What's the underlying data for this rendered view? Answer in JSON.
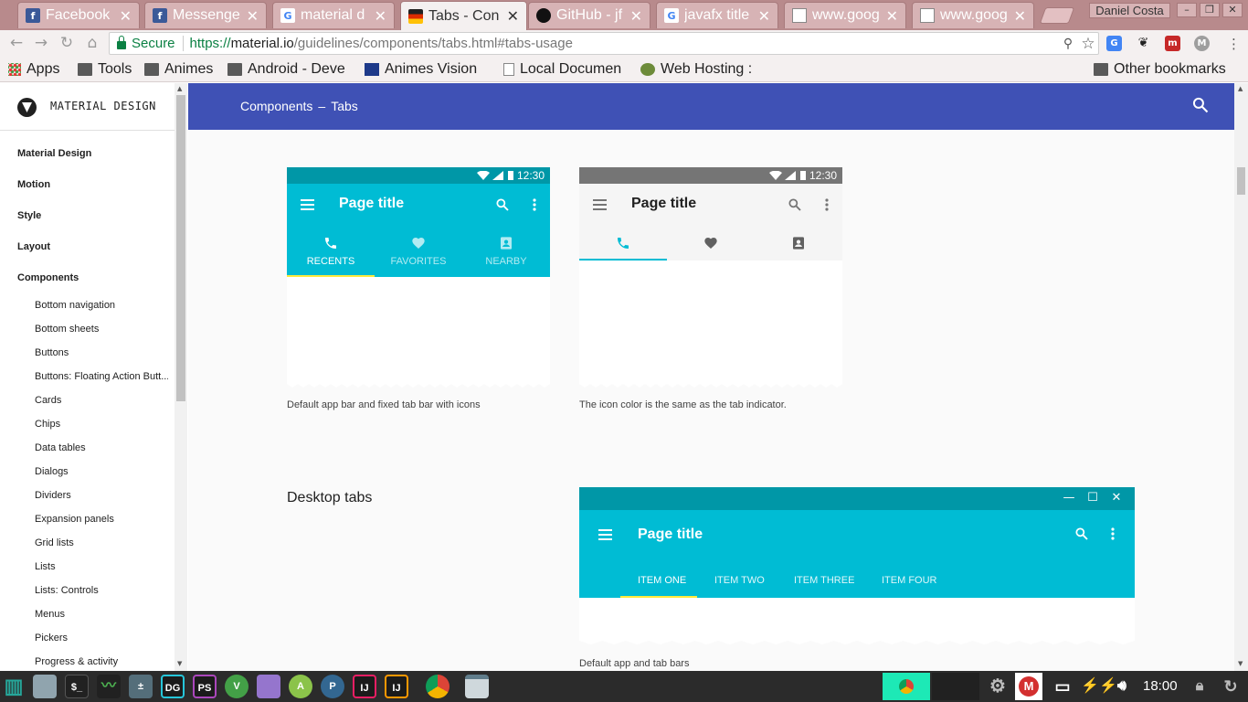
{
  "browser": {
    "tabs": [
      {
        "title": "Facebook",
        "icon": "facebook-icon",
        "color": "#3b5998",
        "letter": "f"
      },
      {
        "title": "Messenger",
        "icon": "facebook-icon",
        "color": "#3b5998",
        "letter": "f"
      },
      {
        "title": "material d",
        "icon": "google-icon",
        "color": "#ffffff",
        "letter": "G"
      },
      {
        "title": "Tabs - Con",
        "icon": "material-icon",
        "color": "#212121",
        "letter": ""
      },
      {
        "title": "GitHub - jf",
        "icon": "github-icon",
        "color": "#111111",
        "letter": ""
      },
      {
        "title": "javafx title",
        "icon": "google-icon",
        "color": "#ffffff",
        "letter": "G"
      },
      {
        "title": "www.goog",
        "icon": "page-icon",
        "color": "#ffffff",
        "letter": ""
      },
      {
        "title": "www.goog",
        "icon": "page-icon",
        "color": "#ffffff",
        "letter": ""
      }
    ],
    "close_glyph": "✕",
    "profile_name": "Daniel Costa",
    "window_controls": [
      "–",
      "❐",
      "✕"
    ]
  },
  "toolbar": {
    "back": "←",
    "forward": "→",
    "reload": "↻",
    "home": "⌂",
    "secure_label": "Secure",
    "url_scheme": "https://",
    "url_host": "material.io",
    "url_path": "/guidelines/components/tabs.html#tabs-usage",
    "zoom_icon": "⚲",
    "star": "☆",
    "menu": "⋮"
  },
  "bookmarks": [
    {
      "label": "Apps",
      "icon": "apps-icon"
    },
    {
      "label": "Tools",
      "icon": "folder-icon"
    },
    {
      "label": "Animes",
      "icon": "folder-icon"
    },
    {
      "label": "Android - Deve",
      "icon": "folder-icon"
    },
    {
      "label": "Animes Vision",
      "icon": "favicon-icon"
    },
    {
      "label": "Local Documen",
      "icon": "page-icon"
    },
    {
      "label": "Web Hosting :",
      "icon": "favicon-icon"
    }
  ],
  "other_bookmarks": "Other bookmarks",
  "sidebar": {
    "brand": "MATERIAL DESIGN",
    "top_items": [
      "Material Design",
      "Motion",
      "Style",
      "Layout",
      "Components"
    ],
    "sub_items": [
      "Bottom navigation",
      "Bottom sheets",
      "Buttons",
      "Buttons: Floating Action Butt...",
      "Cards",
      "Chips",
      "Data tables",
      "Dialogs",
      "Dividers",
      "Expansion panels",
      "Grid lists",
      "Lists",
      "Lists: Controls",
      "Menus",
      "Pickers",
      "Progress & activity"
    ]
  },
  "page": {
    "breadcrumb_section": "Components",
    "breadcrumb_sep": "–",
    "breadcrumb_page": "Tabs",
    "accent": "#3f51b5",
    "mock1": {
      "time": "12:30",
      "title": "Page title",
      "tabs": [
        "RECENTS",
        "FAVORITES",
        "NEARBY"
      ],
      "caption": "Default app bar and fixed tab bar with icons",
      "color": "#00bcd4",
      "status_color": "#0097a7",
      "indicator_color": "#ffeb3b"
    },
    "mock2": {
      "time": "12:30",
      "title": "Page title",
      "caption": "The icon color is the same as the tab indicator.",
      "status_color": "#757575",
      "indicator_color": "#00bcd4"
    },
    "desktop_heading": "Desktop tabs",
    "mock3": {
      "title": "Page title",
      "tabs": [
        "ITEM ONE",
        "ITEM TWO",
        "ITEM THREE",
        "ITEM FOUR"
      ],
      "caption": "Default app and tab bars",
      "window_controls": [
        "—",
        "☐",
        "✕"
      ],
      "indicator_color": "#ffeb3b"
    }
  },
  "taskbar": {
    "apps": [
      "menu",
      "files",
      "terminal",
      "monitor",
      "calculator",
      "datagrip",
      "phpstorm",
      "vivaldi",
      "folder",
      "android-studio",
      "postgres",
      "intellij",
      "intellij-2",
      "chrome",
      "window"
    ],
    "labels": {
      "terminal": "$_",
      "datagrip": "DG",
      "phpstorm": "PS",
      "intellij": "IJ",
      "intellij-2": "IJ"
    },
    "clock": "18:00"
  }
}
